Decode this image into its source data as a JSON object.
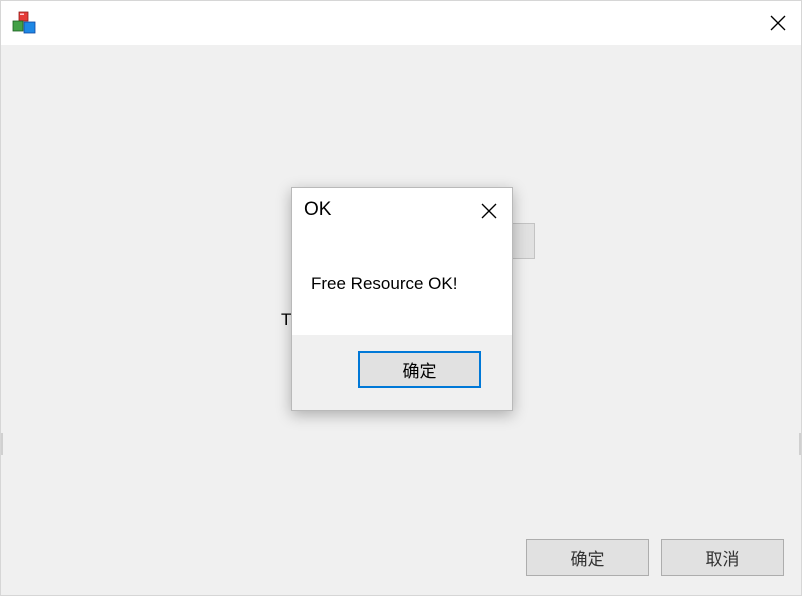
{
  "window": {
    "close_icon": "close-icon",
    "app_icon": "application-icon"
  },
  "background": {
    "partial_label": "T",
    "ok_label": "确定",
    "cancel_label": "取消"
  },
  "dialog": {
    "title": "OK",
    "message": "Free Resource OK!",
    "ok_label": "确定",
    "close_icon": "close-icon"
  },
  "colors": {
    "accent": "#0078d7",
    "window_bg": "#f0f0f0",
    "titlebar_bg": "#ffffff",
    "button_bg": "#e1e1e1"
  }
}
